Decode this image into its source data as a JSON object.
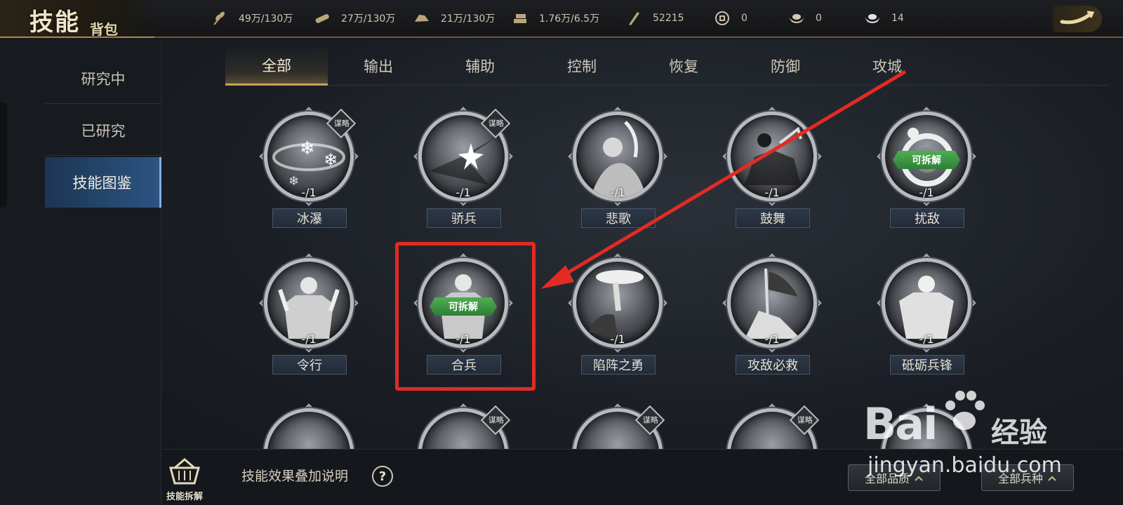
{
  "header": {
    "logo_big": "技能",
    "logo_small": "背包",
    "resources": [
      {
        "icon": "grain-icon",
        "value": "49万/130万"
      },
      {
        "icon": "wood-icon",
        "value": "27万/130万"
      },
      {
        "icon": "stone-icon",
        "value": "21万/130万"
      },
      {
        "icon": "iron-icon",
        "value": "1.76万/6.5万"
      },
      {
        "icon": "decree-icon",
        "value": "52215"
      },
      {
        "icon": "copper-coin-icon",
        "value": "0"
      },
      {
        "icon": "gold-ingot-icon",
        "value": "0"
      },
      {
        "icon": "silver-ingot-icon",
        "value": "14"
      }
    ]
  },
  "sidebar": {
    "items": [
      {
        "label": "研究中"
      },
      {
        "label": "已研究"
      },
      {
        "label": "技能图鉴"
      }
    ]
  },
  "tabs": [
    {
      "label": "全部"
    },
    {
      "label": "输出"
    },
    {
      "label": "辅助"
    },
    {
      "label": "控制"
    },
    {
      "label": "恢复"
    },
    {
      "label": "防御"
    },
    {
      "label": "攻城"
    }
  ],
  "skills": [
    {
      "name": "冰瀑",
      "count": "-/1",
      "badge": "谋略"
    },
    {
      "name": "骄兵",
      "count": "-/1",
      "badge": "谋略"
    },
    {
      "name": "悲歌",
      "count": "-/1"
    },
    {
      "name": "鼓舞",
      "count": "-/1"
    },
    {
      "name": "扰敌",
      "count": "-/1",
      "split_label": "可拆解"
    },
    {
      "name": "令行",
      "count": "-/1"
    },
    {
      "name": "合兵",
      "count": "-/1",
      "split_label": "可拆解"
    },
    {
      "name": "陷阵之勇",
      "count": "-/1"
    },
    {
      "name": "攻敌必救",
      "count": "-/1"
    },
    {
      "name": "砥砺兵锋",
      "count": "-/1"
    }
  ],
  "partial_row_badges": [
    "谋略",
    "谋略",
    "谋略"
  ],
  "bottom": {
    "disassemble_label": "技能拆解",
    "stack_explain": "技能效果叠加说明",
    "help": "?",
    "filter_quality": "全部品质",
    "filter_troop": "全部兵种"
  },
  "watermark": {
    "brand": "Bai",
    "cn": "经验",
    "url": "jingyan.baidu.com"
  },
  "colors": {
    "highlight": "#e22b24",
    "active_side": "#2c5482",
    "tab_accent": "#c9a45d",
    "split_badge": "#3d9a44"
  }
}
